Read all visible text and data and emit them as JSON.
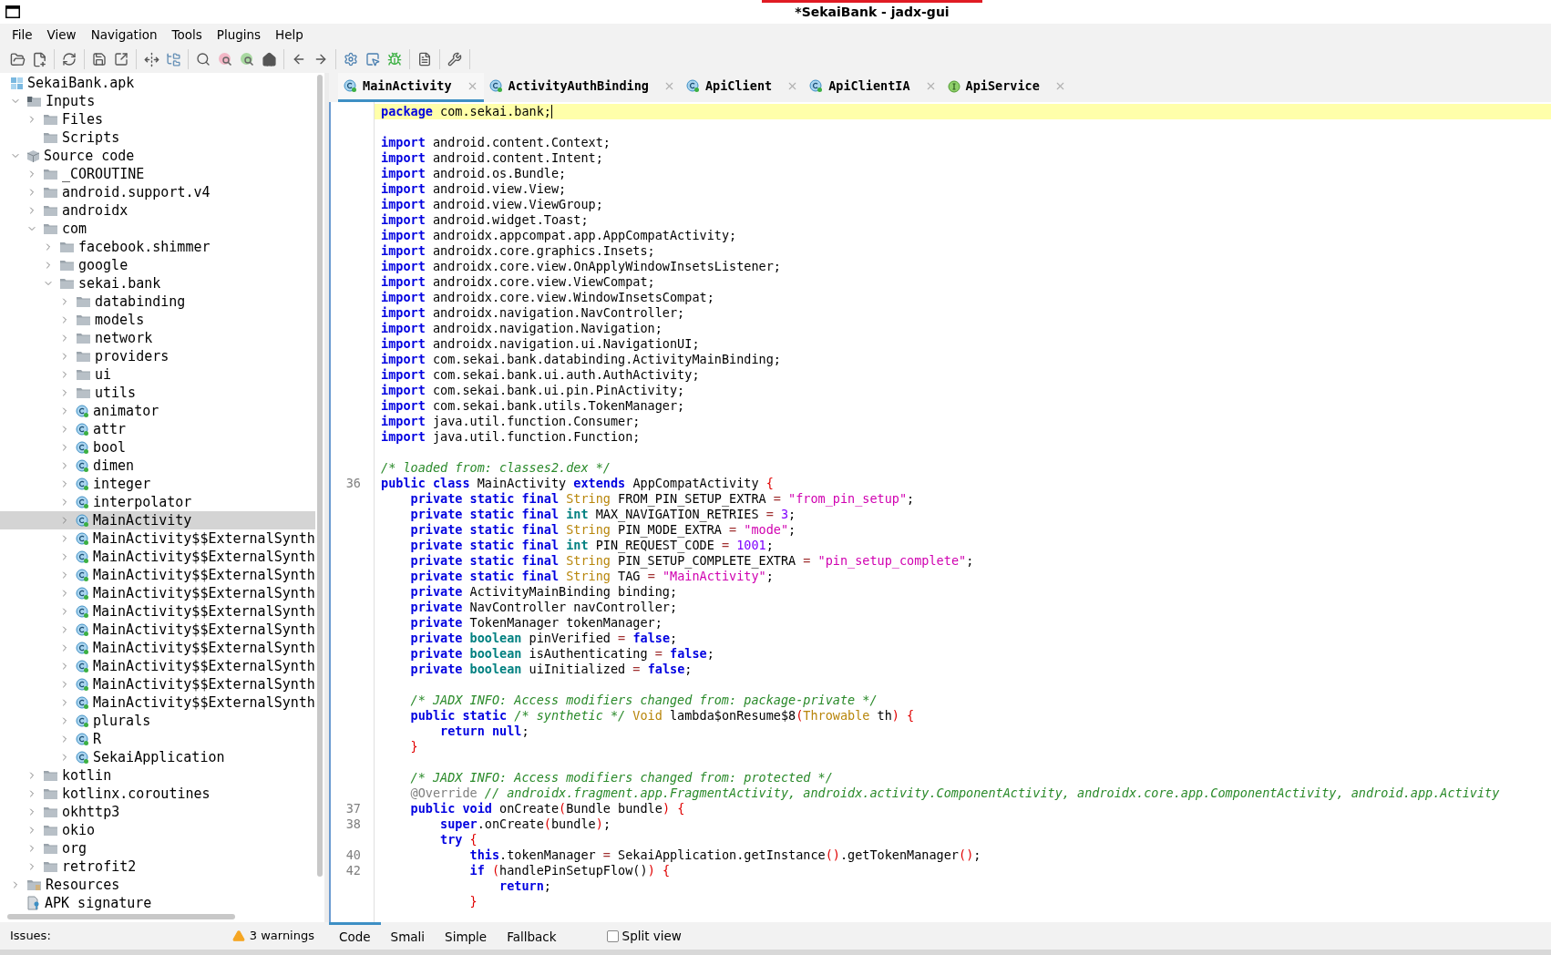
{
  "window": {
    "title": "*SekaiBank - jadx-gui"
  },
  "menu": [
    "File",
    "View",
    "Navigation",
    "Tools",
    "Plugins",
    "Help"
  ],
  "tree": {
    "label": "SekaiBank.apk",
    "kind": "apk",
    "selected": false,
    "children": [
      {
        "label": "Inputs",
        "kind": "inputs",
        "expanded": true,
        "selected": false,
        "children": [
          {
            "label": "Files",
            "kind": "folder",
            "expanded": false,
            "selected": false
          },
          {
            "label": "Scripts",
            "kind": "folder",
            "selected": false
          }
        ]
      },
      {
        "label": "Source code",
        "kind": "source",
        "expanded": true,
        "selected": false,
        "children": [
          {
            "label": "_COROUTINE",
            "kind": "folder",
            "expanded": false,
            "selected": false
          },
          {
            "label": "android.support.v4",
            "kind": "folder",
            "expanded": false,
            "selected": false
          },
          {
            "label": "androidx",
            "kind": "folder",
            "expanded": false,
            "selected": false
          },
          {
            "label": "com",
            "kind": "folder",
            "expanded": true,
            "selected": false,
            "children": [
              {
                "label": "facebook.shimmer",
                "kind": "folder",
                "expanded": false,
                "selected": false
              },
              {
                "label": "google",
                "kind": "folder",
                "expanded": false,
                "selected": false
              },
              {
                "label": "sekai.bank",
                "kind": "folder",
                "expanded": true,
                "selected": false,
                "children": [
                  {
                    "label": "databinding",
                    "kind": "folder",
                    "expanded": false,
                    "selected": false
                  },
                  {
                    "label": "models",
                    "kind": "folder",
                    "expanded": false,
                    "selected": false
                  },
                  {
                    "label": "network",
                    "kind": "folder",
                    "expanded": false,
                    "selected": false
                  },
                  {
                    "label": "providers",
                    "kind": "folder",
                    "expanded": false,
                    "selected": false
                  },
                  {
                    "label": "ui",
                    "kind": "folder",
                    "expanded": false,
                    "selected": false
                  },
                  {
                    "label": "utils",
                    "kind": "folder",
                    "expanded": false,
                    "selected": false
                  },
                  {
                    "label": "animator",
                    "kind": "class",
                    "expanded": false,
                    "selected": false
                  },
                  {
                    "label": "attr",
                    "kind": "class",
                    "expanded": false,
                    "selected": false
                  },
                  {
                    "label": "bool",
                    "kind": "class",
                    "expanded": false,
                    "selected": false
                  },
                  {
                    "label": "dimen",
                    "kind": "class",
                    "expanded": false,
                    "selected": false
                  },
                  {
                    "label": "integer",
                    "kind": "class",
                    "expanded": false,
                    "selected": false
                  },
                  {
                    "label": "interpolator",
                    "kind": "class",
                    "expanded": false,
                    "selected": false
                  },
                  {
                    "label": "MainActivity",
                    "kind": "class",
                    "expanded": false,
                    "selected": true
                  },
                  {
                    "label": "MainActivity$$ExternalSynth",
                    "kind": "class",
                    "expanded": false,
                    "selected": false
                  },
                  {
                    "label": "MainActivity$$ExternalSynth",
                    "kind": "class",
                    "expanded": false,
                    "selected": false
                  },
                  {
                    "label": "MainActivity$$ExternalSynth",
                    "kind": "class",
                    "expanded": false,
                    "selected": false
                  },
                  {
                    "label": "MainActivity$$ExternalSynth",
                    "kind": "class",
                    "expanded": false,
                    "selected": false
                  },
                  {
                    "label": "MainActivity$$ExternalSynth",
                    "kind": "class",
                    "expanded": false,
                    "selected": false
                  },
                  {
                    "label": "MainActivity$$ExternalSynth",
                    "kind": "class",
                    "expanded": false,
                    "selected": false
                  },
                  {
                    "label": "MainActivity$$ExternalSynth",
                    "kind": "class",
                    "expanded": false,
                    "selected": false
                  },
                  {
                    "label": "MainActivity$$ExternalSynth",
                    "kind": "class",
                    "expanded": false,
                    "selected": false
                  },
                  {
                    "label": "MainActivity$$ExternalSynth",
                    "kind": "class",
                    "expanded": false,
                    "selected": false
                  },
                  {
                    "label": "MainActivity$$ExternalSynth",
                    "kind": "class",
                    "expanded": false,
                    "selected": false
                  },
                  {
                    "label": "plurals",
                    "kind": "class",
                    "expanded": false,
                    "selected": false
                  },
                  {
                    "label": "R",
                    "kind": "class",
                    "expanded": false,
                    "selected": false
                  },
                  {
                    "label": "SekaiApplication",
                    "kind": "class",
                    "expanded": false,
                    "selected": false
                  }
                ]
              }
            ]
          },
          {
            "label": "kotlin",
            "kind": "folder",
            "expanded": false,
            "selected": false
          },
          {
            "label": "kotlinx.coroutines",
            "kind": "folder",
            "expanded": false,
            "selected": false
          },
          {
            "label": "okhttp3",
            "kind": "folder",
            "expanded": false,
            "selected": false
          },
          {
            "label": "okio",
            "kind": "folder",
            "expanded": false,
            "selected": false
          },
          {
            "label": "org",
            "kind": "folder",
            "expanded": false,
            "selected": false
          },
          {
            "label": "retrofit2",
            "kind": "folder",
            "expanded": false,
            "selected": false
          }
        ]
      },
      {
        "label": "Resources",
        "kind": "resources",
        "expanded": false,
        "selected": false
      },
      {
        "label": "APK signature",
        "kind": "signature",
        "selected": false
      }
    ]
  },
  "tabs": [
    {
      "label": "MainActivity",
      "kind": "class",
      "selected": true
    },
    {
      "label": "ActivityAuthBinding",
      "kind": "class",
      "selected": false
    },
    {
      "label": "ApiClient",
      "kind": "class",
      "selected": false
    },
    {
      "label": "ApiClientIA",
      "kind": "class",
      "selected": false
    },
    {
      "label": "ApiService",
      "kind": "interface",
      "selected": false
    }
  ],
  "code": [
    {
      "highlighted": true,
      "tokens": [
        {
          "kind": "k",
          "text": "package"
        },
        {
          "kind": "x",
          "text": " com.sekai.bank;"
        }
      ]
    },
    {
      "highlighted": false
    },
    {
      "highlighted": false,
      "tokens": [
        {
          "kind": "k",
          "text": "import"
        },
        {
          "kind": "x",
          "text": " android.content.Context;"
        }
      ]
    },
    {
      "highlighted": false,
      "tokens": [
        {
          "kind": "k",
          "text": "import"
        },
        {
          "kind": "x",
          "text": " android.content.Intent;"
        }
      ]
    },
    {
      "highlighted": false,
      "tokens": [
        {
          "kind": "k",
          "text": "import"
        },
        {
          "kind": "x",
          "text": " android.os.Bundle;"
        }
      ]
    },
    {
      "highlighted": false,
      "tokens": [
        {
          "kind": "k",
          "text": "import"
        },
        {
          "kind": "x",
          "text": " android.view.View;"
        }
      ]
    },
    {
      "highlighted": false,
      "tokens": [
        {
          "kind": "k",
          "text": "import"
        },
        {
          "kind": "x",
          "text": " android.view.ViewGroup;"
        }
      ]
    },
    {
      "highlighted": false,
      "tokens": [
        {
          "kind": "k",
          "text": "import"
        },
        {
          "kind": "x",
          "text": " android.widget.Toast;"
        }
      ]
    },
    {
      "highlighted": false,
      "tokens": [
        {
          "kind": "k",
          "text": "import"
        },
        {
          "kind": "x",
          "text": " androidx.appcompat.app.AppCompatActivity;"
        }
      ]
    },
    {
      "highlighted": false,
      "tokens": [
        {
          "kind": "k",
          "text": "import"
        },
        {
          "kind": "x",
          "text": " androidx.core.graphics.Insets;"
        }
      ]
    },
    {
      "highlighted": false,
      "tokens": [
        {
          "kind": "k",
          "text": "import"
        },
        {
          "kind": "x",
          "text": " androidx.core.view.OnApplyWindowInsetsListener;"
        }
      ]
    },
    {
      "highlighted": false,
      "tokens": [
        {
          "kind": "k",
          "text": "import"
        },
        {
          "kind": "x",
          "text": " androidx.core.view.ViewCompat;"
        }
      ]
    },
    {
      "highlighted": false,
      "tokens": [
        {
          "kind": "k",
          "text": "import"
        },
        {
          "kind": "x",
          "text": " androidx.core.view.WindowInsetsCompat;"
        }
      ]
    },
    {
      "highlighted": false,
      "tokens": [
        {
          "kind": "k",
          "text": "import"
        },
        {
          "kind": "x",
          "text": " androidx.navigation.NavController;"
        }
      ]
    },
    {
      "highlighted": false,
      "tokens": [
        {
          "kind": "k",
          "text": "import"
        },
        {
          "kind": "x",
          "text": " androidx.navigation.Navigation;"
        }
      ]
    },
    {
      "highlighted": false,
      "tokens": [
        {
          "kind": "k",
          "text": "import"
        },
        {
          "kind": "x",
          "text": " androidx.navigation.ui.NavigationUI;"
        }
      ]
    },
    {
      "highlighted": false,
      "tokens": [
        {
          "kind": "k",
          "text": "import"
        },
        {
          "kind": "x",
          "text": " com.sekai.bank.databinding.ActivityMainBinding;"
        }
      ]
    },
    {
      "highlighted": false,
      "tokens": [
        {
          "kind": "k",
          "text": "import"
        },
        {
          "kind": "x",
          "text": " com.sekai.bank.ui.auth.AuthActivity;"
        }
      ]
    },
    {
      "highlighted": false,
      "tokens": [
        {
          "kind": "k",
          "text": "import"
        },
        {
          "kind": "x",
          "text": " com.sekai.bank.ui.pin.PinActivity;"
        }
      ]
    },
    {
      "highlighted": false,
      "tokens": [
        {
          "kind": "k",
          "text": "import"
        },
        {
          "kind": "x",
          "text": " com.sekai.bank.utils.TokenManager;"
        }
      ]
    },
    {
      "highlighted": false,
      "tokens": [
        {
          "kind": "k",
          "text": "import"
        },
        {
          "kind": "x",
          "text": " java.util.function.Consumer;"
        }
      ]
    },
    {
      "highlighted": false,
      "tokens": [
        {
          "kind": "k",
          "text": "import"
        },
        {
          "kind": "x",
          "text": " java.util.function.Function;"
        }
      ]
    },
    {
      "highlighted": false
    },
    {
      "highlighted": false,
      "tokens": [
        {
          "kind": "c",
          "text": "/* loaded from: classes2.dex */"
        }
      ]
    },
    {
      "num": "36",
      "highlighted": false,
      "tokens": [
        {
          "kind": "k",
          "text": "public class"
        },
        {
          "kind": "x",
          "text": " MainActivity "
        },
        {
          "kind": "k",
          "text": "extends"
        },
        {
          "kind": "x",
          "text": " AppCompatActivity "
        },
        {
          "kind": "b",
          "text": "{"
        }
      ]
    },
    {
      "highlighted": false,
      "tokens": [
        {
          "kind": "k",
          "text": "    private static final"
        },
        {
          "kind": "t",
          "text": " String"
        },
        {
          "kind": "x",
          "text": " FROM_PIN_SETUP_EXTRA "
        },
        {
          "kind": "o",
          "text": "="
        },
        {
          "kind": "s",
          "text": " \"from_pin_setup\""
        },
        {
          "kind": "x",
          "text": ";"
        }
      ]
    },
    {
      "highlighted": false,
      "tokens": [
        {
          "kind": "k",
          "text": "    private static final"
        },
        {
          "kind": "p",
          "text": " int"
        },
        {
          "kind": "x",
          "text": " MAX_NAVIGATION_RETRIES "
        },
        {
          "kind": "o",
          "text": "="
        },
        {
          "kind": "n",
          "text": " 3"
        },
        {
          "kind": "x",
          "text": ";"
        }
      ]
    },
    {
      "highlighted": false,
      "tokens": [
        {
          "kind": "k",
          "text": "    private static final"
        },
        {
          "kind": "t",
          "text": " String"
        },
        {
          "kind": "x",
          "text": " PIN_MODE_EXTRA "
        },
        {
          "kind": "o",
          "text": "="
        },
        {
          "kind": "s",
          "text": " \"mode\""
        },
        {
          "kind": "x",
          "text": ";"
        }
      ]
    },
    {
      "highlighted": false,
      "tokens": [
        {
          "kind": "k",
          "text": "    private static final"
        },
        {
          "kind": "p",
          "text": " int"
        },
        {
          "kind": "x",
          "text": " PIN_REQUEST_CODE "
        },
        {
          "kind": "o",
          "text": "="
        },
        {
          "kind": "n",
          "text": " 1001"
        },
        {
          "kind": "x",
          "text": ";"
        }
      ]
    },
    {
      "highlighted": false,
      "tokens": [
        {
          "kind": "k",
          "text": "    private static final"
        },
        {
          "kind": "t",
          "text": " String"
        },
        {
          "kind": "x",
          "text": " PIN_SETUP_COMPLETE_EXTRA "
        },
        {
          "kind": "o",
          "text": "="
        },
        {
          "kind": "s",
          "text": " \"pin_setup_complete\""
        },
        {
          "kind": "x",
          "text": ";"
        }
      ]
    },
    {
      "highlighted": false,
      "tokens": [
        {
          "kind": "k",
          "text": "    private static final"
        },
        {
          "kind": "t",
          "text": " String"
        },
        {
          "kind": "x",
          "text": " TAG "
        },
        {
          "kind": "o",
          "text": "="
        },
        {
          "kind": "s",
          "text": " \"MainActivity\""
        },
        {
          "kind": "x",
          "text": ";"
        }
      ]
    },
    {
      "highlighted": false,
      "tokens": [
        {
          "kind": "k",
          "text": "    private"
        },
        {
          "kind": "x",
          "text": " ActivityMainBinding binding;"
        }
      ]
    },
    {
      "highlighted": false,
      "tokens": [
        {
          "kind": "k",
          "text": "    private"
        },
        {
          "kind": "x",
          "text": " NavController navController;"
        }
      ]
    },
    {
      "highlighted": false,
      "tokens": [
        {
          "kind": "k",
          "text": "    private"
        },
        {
          "kind": "x",
          "text": " TokenManager tokenManager;"
        }
      ]
    },
    {
      "highlighted": false,
      "tokens": [
        {
          "kind": "k",
          "text": "    private"
        },
        {
          "kind": "p",
          "text": " boolean"
        },
        {
          "kind": "x",
          "text": " pinVerified "
        },
        {
          "kind": "o",
          "text": "="
        },
        {
          "kind": "k",
          "text": " false"
        },
        {
          "kind": "x",
          "text": ";"
        }
      ]
    },
    {
      "highlighted": false,
      "tokens": [
        {
          "kind": "k",
          "text": "    private"
        },
        {
          "kind": "p",
          "text": " boolean"
        },
        {
          "kind": "x",
          "text": " isAuthenticating "
        },
        {
          "kind": "o",
          "text": "="
        },
        {
          "kind": "k",
          "text": " false"
        },
        {
          "kind": "x",
          "text": ";"
        }
      ]
    },
    {
      "highlighted": false,
      "tokens": [
        {
          "kind": "k",
          "text": "    private"
        },
        {
          "kind": "p",
          "text": " boolean"
        },
        {
          "kind": "x",
          "text": " uiInitialized "
        },
        {
          "kind": "o",
          "text": "="
        },
        {
          "kind": "k",
          "text": " false"
        },
        {
          "kind": "x",
          "text": ";"
        }
      ]
    },
    {
      "highlighted": false
    },
    {
      "highlighted": false,
      "tokens": [
        {
          "kind": "c",
          "text": "    /* JADX INFO: Access modifiers changed from: package-private */"
        }
      ]
    },
    {
      "highlighted": false,
      "tokens": [
        {
          "kind": "k",
          "text": "    public static"
        },
        {
          "kind": "c",
          "text": " /* synthetic */"
        },
        {
          "kind": "t",
          "text": " Void"
        },
        {
          "kind": "x",
          "text": " lambda$onResume$8"
        },
        {
          "kind": "b",
          "text": "("
        },
        {
          "kind": "t",
          "text": "Throwable"
        },
        {
          "kind": "x",
          "text": " th"
        },
        {
          "kind": "b",
          "text": ") {"
        }
      ]
    },
    {
      "highlighted": false,
      "tokens": [
        {
          "kind": "k",
          "text": "        return null"
        },
        {
          "kind": "x",
          "text": ";"
        }
      ]
    },
    {
      "highlighted": false,
      "tokens": [
        {
          "kind": "b",
          "text": "    }"
        }
      ]
    },
    {
      "highlighted": false
    },
    {
      "highlighted": false,
      "tokens": [
        {
          "kind": "c",
          "text": "    /* JADX INFO: Access modifiers changed from: protected */"
        }
      ]
    },
    {
      "highlighted": false,
      "tokens": [
        {
          "kind": "a",
          "text": "    @Override"
        },
        {
          "kind": "c",
          "text": " // androidx.fragment.app.FragmentActivity, androidx.activity.ComponentActivity, androidx.core.app.ComponentActivity, android.app.Activity"
        }
      ]
    },
    {
      "num": "37",
      "highlighted": false,
      "tokens": [
        {
          "kind": "k",
          "text": "    public void"
        },
        {
          "kind": "x",
          "text": " onCreate"
        },
        {
          "kind": "b",
          "text": "("
        },
        {
          "kind": "x",
          "text": "Bundle bundle"
        },
        {
          "kind": "b",
          "text": ") {"
        }
      ]
    },
    {
      "num": "38",
      "highlighted": false,
      "tokens": [
        {
          "kind": "k",
          "text": "        super"
        },
        {
          "kind": "x",
          "text": ".onCreate"
        },
        {
          "kind": "b",
          "text": "("
        },
        {
          "kind": "x",
          "text": "bundle"
        },
        {
          "kind": "b",
          "text": ")"
        },
        {
          "kind": "x",
          "text": ";"
        }
      ]
    },
    {
      "highlighted": false,
      "tokens": [
        {
          "kind": "k",
          "text": "        try"
        },
        {
          "kind": "b",
          "text": " {"
        }
      ]
    },
    {
      "num": "40",
      "highlighted": false,
      "tokens": [
        {
          "kind": "k",
          "text": "            this"
        },
        {
          "kind": "x",
          "text": ".tokenManager "
        },
        {
          "kind": "o",
          "text": "="
        },
        {
          "kind": "x",
          "text": " SekaiApplication.getInstance"
        },
        {
          "kind": "b",
          "text": "()"
        },
        {
          "kind": "x",
          "text": ".getTokenManager"
        },
        {
          "kind": "b",
          "text": "()"
        },
        {
          "kind": "x",
          "text": ";"
        }
      ]
    },
    {
      "num": "42",
      "highlighted": false,
      "tokens": [
        {
          "kind": "k",
          "text": "            if"
        },
        {
          "kind": "b",
          "text": " ("
        },
        {
          "kind": "x",
          "text": "handlePinSetupFlow()"
        },
        {
          "kind": "b",
          "text": ") {"
        }
      ]
    },
    {
      "highlighted": false,
      "tokens": [
        {
          "kind": "k",
          "text": "                return"
        },
        {
          "kind": "x",
          "text": ";"
        }
      ]
    },
    {
      "highlighted": false,
      "tokens": [
        {
          "kind": "b",
          "text": "            }"
        }
      ]
    }
  ],
  "view_tabs": [
    {
      "label": "Code",
      "selected": true
    },
    {
      "label": "Smali",
      "selected": false
    },
    {
      "label": "Simple",
      "selected": false
    },
    {
      "label": "Fallback",
      "selected": false
    }
  ],
  "split_view": {
    "label": "Split view",
    "checked": false
  },
  "status": {
    "issues_label": "Issues:",
    "warnings": "3 warnings"
  }
}
